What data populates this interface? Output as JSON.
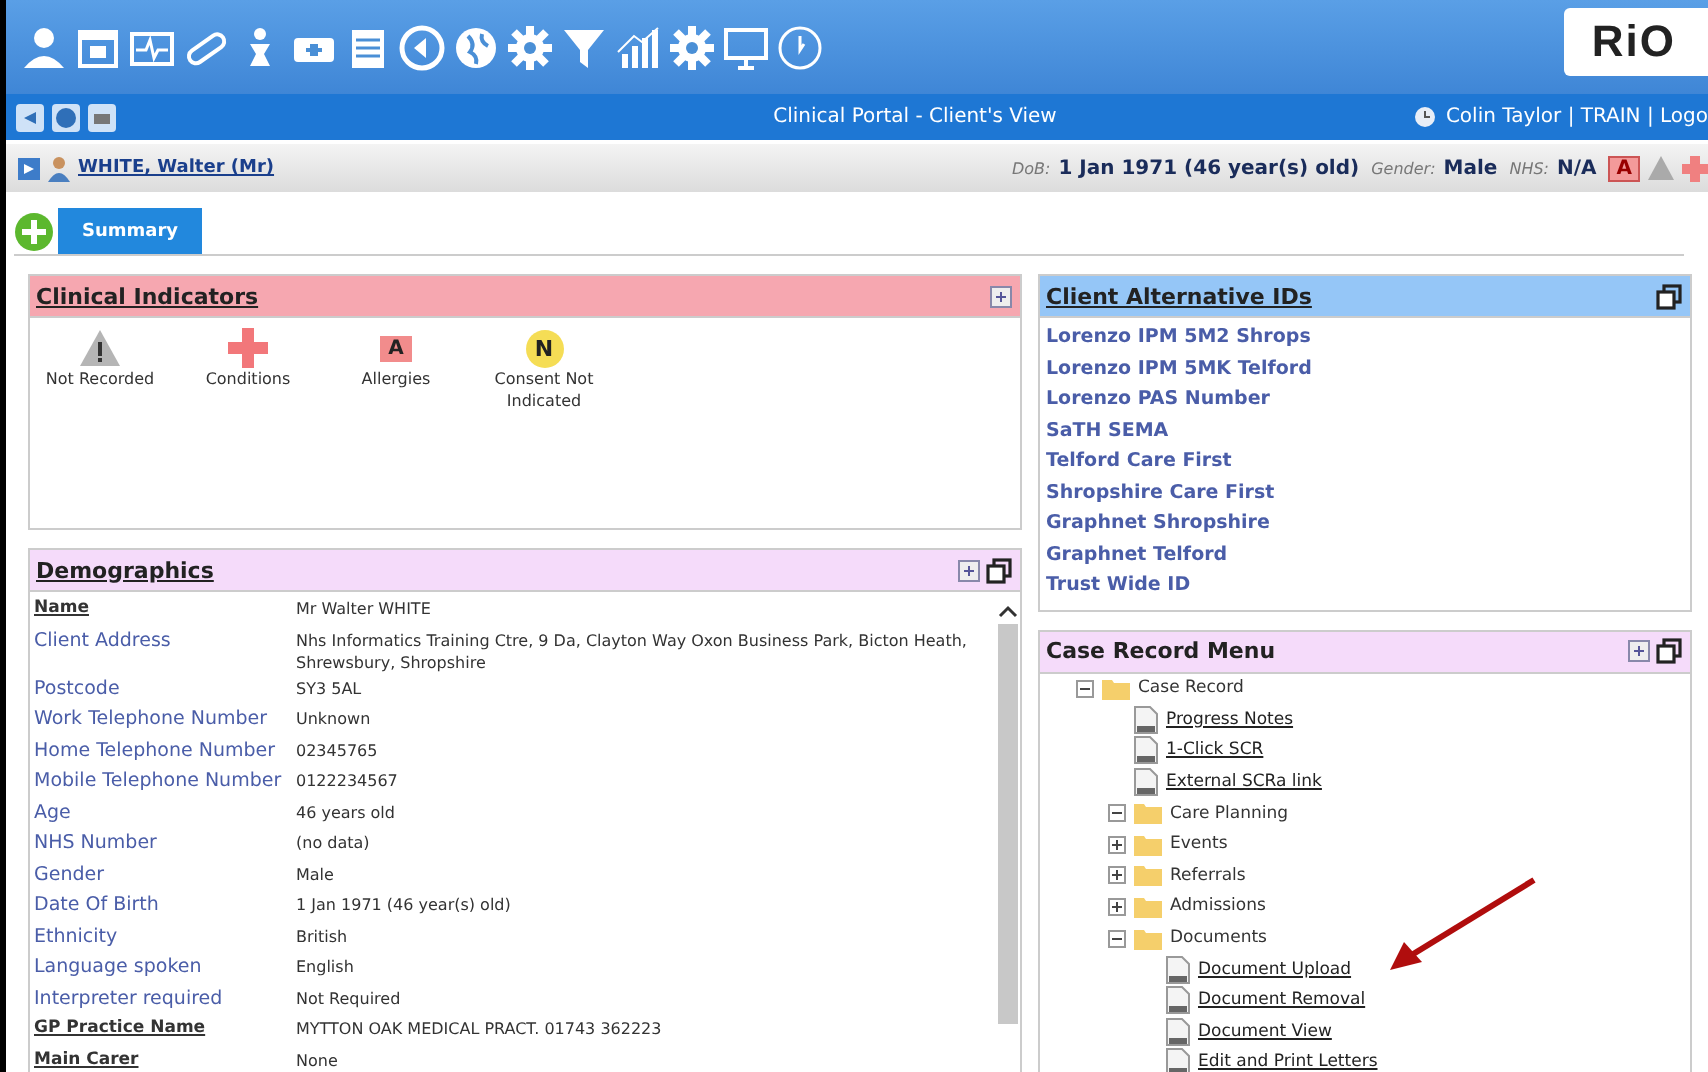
{
  "header": {
    "logo": "RiO",
    "title": "Clinical Portal - Client's View",
    "user_info": "Colin Taylor | TRAIN | Logo"
  },
  "patient_bar": {
    "name": "WHITE, Walter (Mr)",
    "dob_label": "DoB:",
    "dob": "1 Jan 1971 (46 year(s) old)",
    "gender_label": "Gender:",
    "gender": "Male",
    "nhs_label": "NHS:",
    "nhs": "N/A",
    "alert_badge": "A"
  },
  "tabs": [
    {
      "label": "Summary",
      "selected": true
    }
  ],
  "clinical_indicators": {
    "title": "Clinical Indicators",
    "items": [
      {
        "kind": "warning",
        "label": "Not Recorded"
      },
      {
        "kind": "cross",
        "label": "Conditions"
      },
      {
        "kind": "letter",
        "badge": "A",
        "label": "Allergies"
      },
      {
        "kind": "circle",
        "badge": "N",
        "label": "Consent Not Indicated"
      }
    ]
  },
  "demographics": {
    "title": "Demographics",
    "rows": [
      {
        "label": "Name",
        "value": "Mr Walter WHITE",
        "underlined": true
      },
      {
        "label": "Client Address",
        "value": "Nhs Informatics Training Ctre, 9 Da, Clayton Way Oxon Business Park, Bicton Heath, Shrewsbury, Shropshire",
        "underlined": false
      },
      {
        "label": "Postcode",
        "value": "SY3 5AL",
        "underlined": false
      },
      {
        "label": "Work Telephone Number",
        "value": "Unknown",
        "underlined": false
      },
      {
        "label": "Home Telephone Number",
        "value": "02345765",
        "underlined": false
      },
      {
        "label": "Mobile Telephone Number",
        "value": "0122234567",
        "underlined": false
      },
      {
        "label": "Age",
        "value": "46 years old",
        "underlined": false
      },
      {
        "label": "NHS Number",
        "value": "(no data)",
        "underlined": false
      },
      {
        "label": "Gender",
        "value": "Male",
        "underlined": false
      },
      {
        "label": "Date Of Birth",
        "value": "1 Jan 1971 (46 year(s) old)",
        "underlined": false
      },
      {
        "label": "Ethnicity",
        "value": "British",
        "underlined": false
      },
      {
        "label": "Language spoken",
        "value": "English",
        "underlined": false
      },
      {
        "label": "Interpreter required",
        "value": "Not Required",
        "underlined": false
      },
      {
        "label": "GP Practice Name",
        "value": "MYTTON OAK MEDICAL PRACT. 01743 362223",
        "underlined": true
      },
      {
        "label": "Main Carer",
        "value": "None",
        "underlined": true
      }
    ]
  },
  "alternative_ids": {
    "title": "Client Alternative IDs",
    "items": [
      "Lorenzo IPM 5M2 Shrops",
      "Lorenzo IPM 5MK Telford",
      "Lorenzo PAS Number",
      "SaTH SEMA",
      "Telford Care First",
      "Shropshire Care First",
      "Graphnet Shropshire",
      "Graphnet Telford",
      "Trust Wide ID"
    ]
  },
  "case_record_menu": {
    "title": "Case Record Menu",
    "tree": [
      {
        "kind": "folder",
        "label": "Case Record",
        "expanded": true,
        "children": [
          {
            "kind": "document",
            "label": "Progress Notes"
          },
          {
            "kind": "document",
            "label": "1-Click SCR"
          },
          {
            "kind": "document",
            "label": "External SCRa link"
          },
          {
            "kind": "folder",
            "label": "Care Planning",
            "expanded": true
          },
          {
            "kind": "folder",
            "label": "Events",
            "expanded": false
          },
          {
            "kind": "folder",
            "label": "Referrals",
            "expanded": false
          },
          {
            "kind": "folder",
            "label": "Admissions",
            "expanded": false
          },
          {
            "kind": "folder",
            "label": "Documents",
            "expanded": true,
            "children": [
              {
                "kind": "document",
                "label": "Document Upload"
              },
              {
                "kind": "document",
                "label": "Document Removal"
              },
              {
                "kind": "document",
                "label": "Document View"
              },
              {
                "kind": "document",
                "label": "Edit and Print Letters"
              }
            ]
          }
        ]
      }
    ]
  }
}
